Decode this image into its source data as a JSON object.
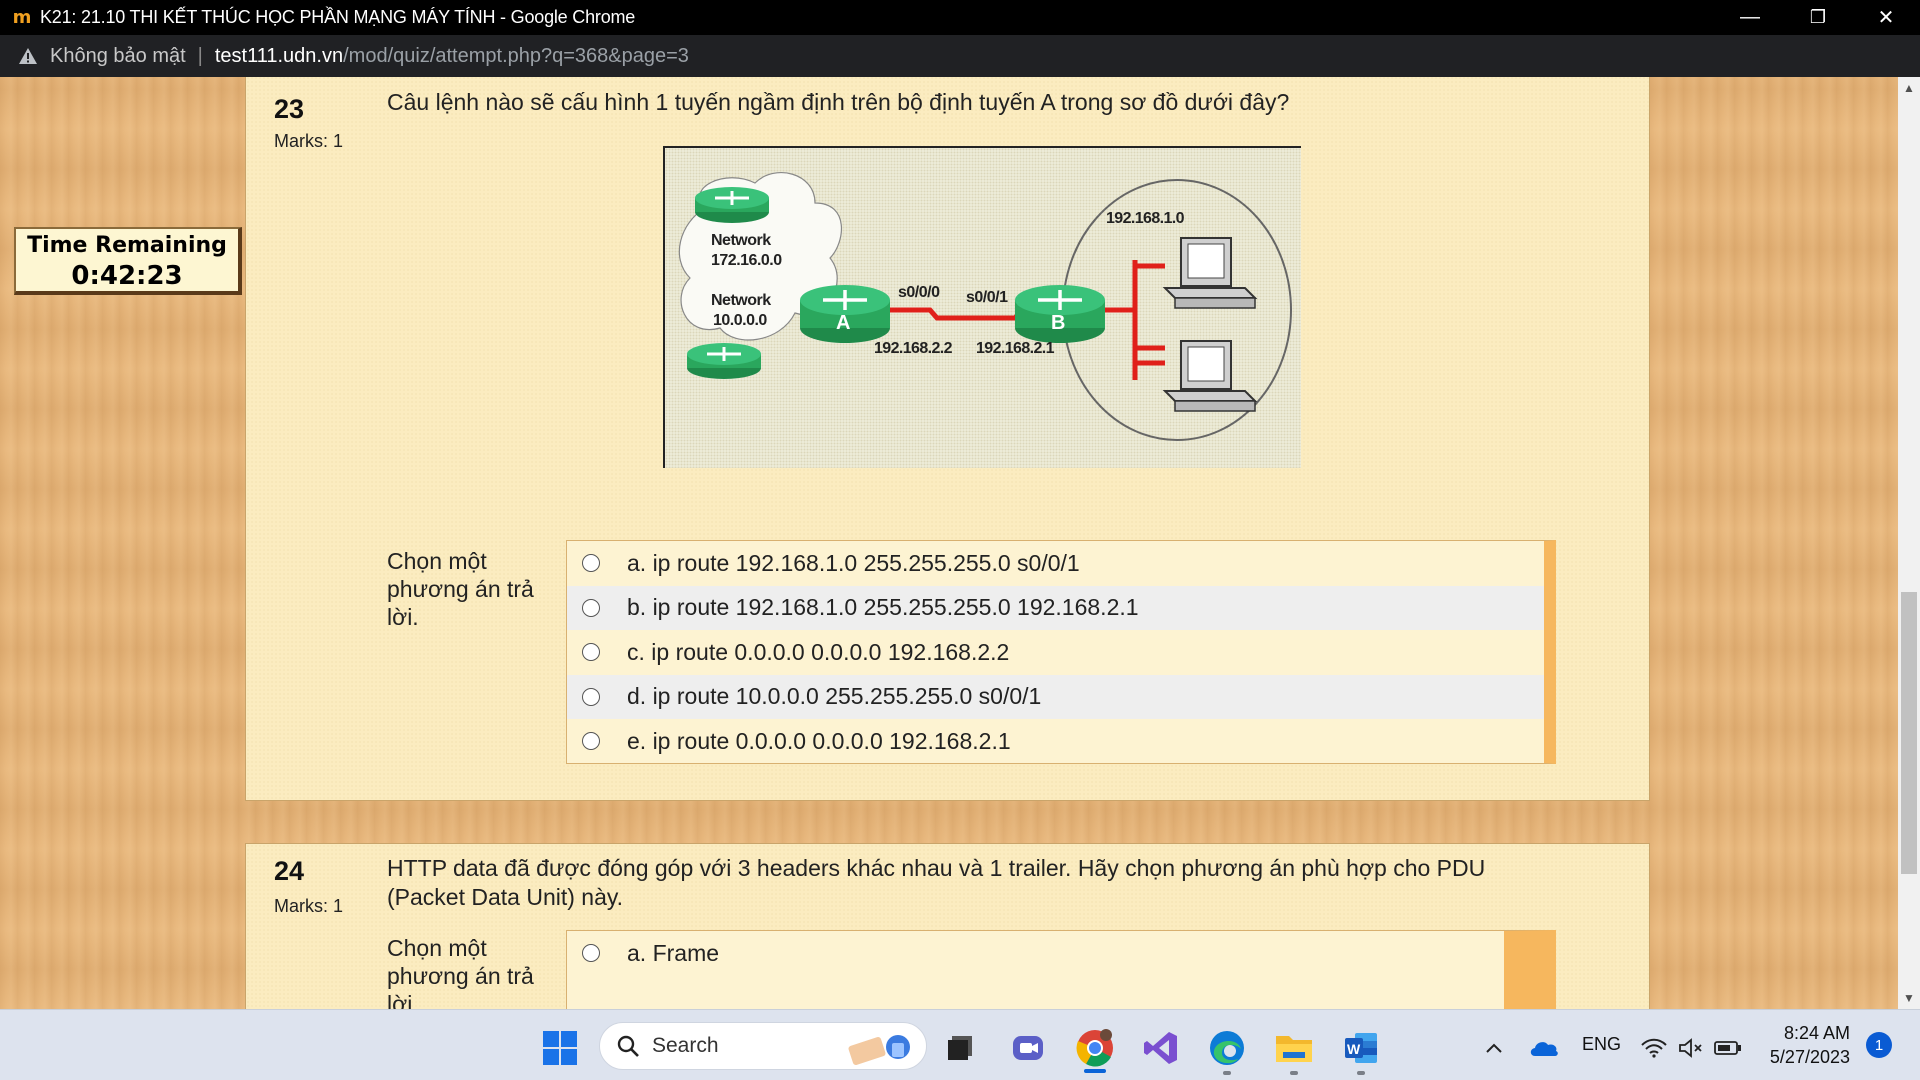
{
  "window": {
    "title": "K21: 21.10 THI KẾT THÚC HỌC PHẦN MẠNG MÁY TÍNH - Google Chrome",
    "app_icon_text": "m",
    "minimize": "—",
    "restore": "❐",
    "close": "✕"
  },
  "address": {
    "security_label": "Không bảo mật",
    "separator": "|",
    "host": "test111.udn.vn",
    "path": "/mod/quiz/attempt.php?q=368&page=3"
  },
  "timer": {
    "label": "Time Remaining",
    "value": "0:42:23"
  },
  "questions": [
    {
      "number": "23",
      "marks": "Marks: 1",
      "text": "Câu lệnh nào sẽ cấu hình 1 tuyến ngầm định trên bộ định tuyến A trong sơ đồ dưới đây?",
      "prompt": "Chọn một phương án trả lời.",
      "figure": {
        "network1": "Network",
        "network1_addr": "172.16.0.0",
        "network2": "Network",
        "network2_addr": "10.0.0.0",
        "router_a": "A",
        "router_b": "B",
        "a_iface": "s0/0/0",
        "b_iface": "s0/0/1",
        "a_ip": "192.168.2.2",
        "b_ip": "192.168.2.1",
        "lan": "192.168.1.0"
      },
      "options": [
        "a. ip route 192.168.1.0 255.255.255.0 s0/0/1",
        "b. ip route 192.168.1.0 255.255.255.0 192.168.2.1",
        "c. ip route 0.0.0.0 0.0.0.0 192.168.2.2",
        "d. ip route 10.0.0.0 255.255.255.0 s0/0/1",
        "e. ip route 0.0.0.0 0.0.0.0 192.168.2.1"
      ]
    },
    {
      "number": "24",
      "marks": "Marks: 1",
      "text": "HTTP data đã được đóng góp với 3 headers khác nhau và 1 trailer. Hãy chọn phương án phù hợp cho PDU (Packet Data Unit) này.",
      "prompt": "Chọn một phương án trả lời.",
      "options": [
        "a. Frame"
      ]
    }
  ],
  "taskbar": {
    "search_placeholder": "Search",
    "language": "ENG",
    "time": "8:24 AM",
    "date": "5/27/2023",
    "notification_count": "1"
  }
}
